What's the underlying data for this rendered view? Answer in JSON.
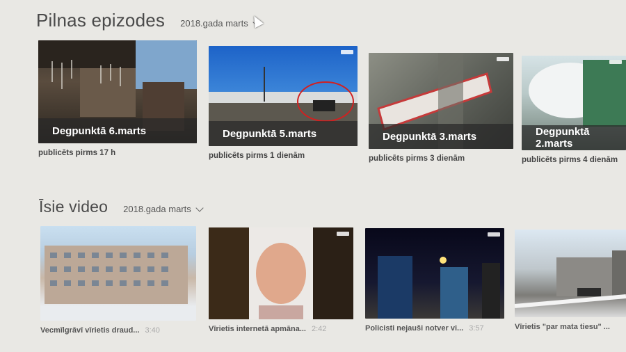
{
  "episodes_section": {
    "title": "Pilnas epizodes",
    "date_filter": "2018.gada marts",
    "items": [
      {
        "title": "Degpunktā 6.marts",
        "published": "publicēts pirms 17 h"
      },
      {
        "title": "Degpunktā 5.marts",
        "published": "publicēts pirms 1 dienām"
      },
      {
        "title": "Degpunktā 3.marts",
        "published": "publicēts pirms 3 dienām"
      },
      {
        "title": "Degpunktā 2.marts",
        "published": "publicēts pirms 4 dienām"
      }
    ]
  },
  "short_videos_section": {
    "title": "Īsie video",
    "date_filter": "2018.gada marts",
    "items": [
      {
        "title": "Vecmīlgrāvī vīrietis draud...",
        "duration": "3:40"
      },
      {
        "title": "Vīrietis internetā apmāna...",
        "duration": "2:42"
      },
      {
        "title": "Policisti nejauši notver vi...",
        "duration": "3:57"
      },
      {
        "title": "Vīrietis \"par mata tiesu\" ...",
        "duration": ""
      }
    ]
  },
  "colors": {
    "background": "#e9e8e4",
    "title_bar": "#2a2a2a",
    "text": "#3a3a3a",
    "duration": "#aaaaaa"
  }
}
